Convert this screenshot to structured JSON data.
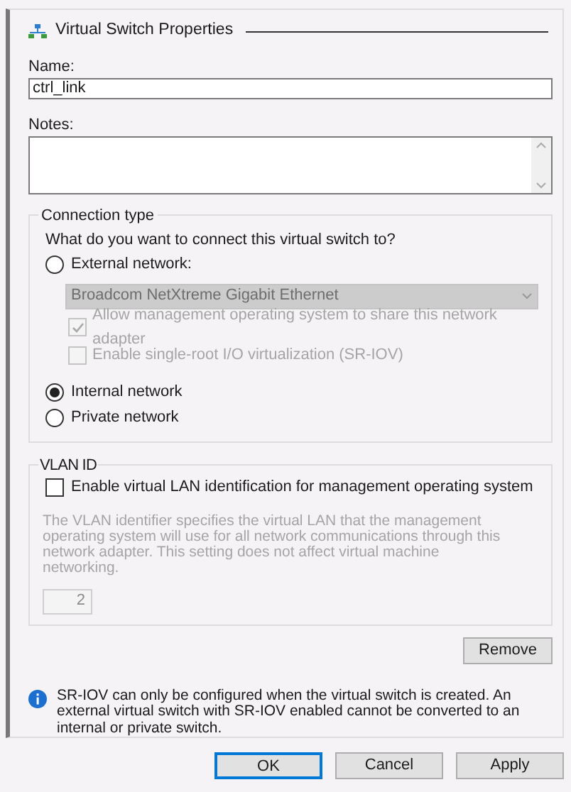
{
  "section": {
    "title": "Virtual Switch Properties"
  },
  "name_field": {
    "label": "Name:",
    "value": "ctrl_link"
  },
  "notes_field": {
    "label": "Notes:"
  },
  "connection_type": {
    "title": "Connection type",
    "question": "What do you want to connect this virtual switch to?",
    "options": [
      {
        "label": "External network:",
        "selected": false,
        "adapter": {
          "value": "Broadcom NetXtreme Gigabit Ethernet",
          "disabled": true
        },
        "checkboxes": [
          {
            "label": "Allow management operating system to share this network adapter",
            "checked": true,
            "disabled": true
          },
          {
            "label": "Enable single-root I/O virtualization (SR-IOV)",
            "checked": false,
            "disabled": true
          }
        ]
      },
      {
        "label": "Internal network",
        "selected": true
      },
      {
        "label": "Private network",
        "selected": false
      }
    ]
  },
  "vlan": {
    "title": "VLAN ID",
    "checkbox": {
      "label": "Enable virtual LAN identification for management operating system",
      "checked": false
    },
    "description": "The VLAN identifier specifies the virtual LAN that the management operating system will use for all network communications through this network adapter. This setting does not affect virtual machine networking.",
    "vlan_id": {
      "value": "2",
      "disabled": true
    }
  },
  "remove_button": "Remove",
  "info": "SR-IOV can only be configured when the virtual switch is created. An external virtual switch with SR-IOV enabled cannot be converted to an internal or private switch.",
  "buttons": [
    {
      "label": "OK",
      "default": true
    },
    {
      "label": "Cancel",
      "default": false
    },
    {
      "label": "Apply",
      "default": false
    }
  ]
}
